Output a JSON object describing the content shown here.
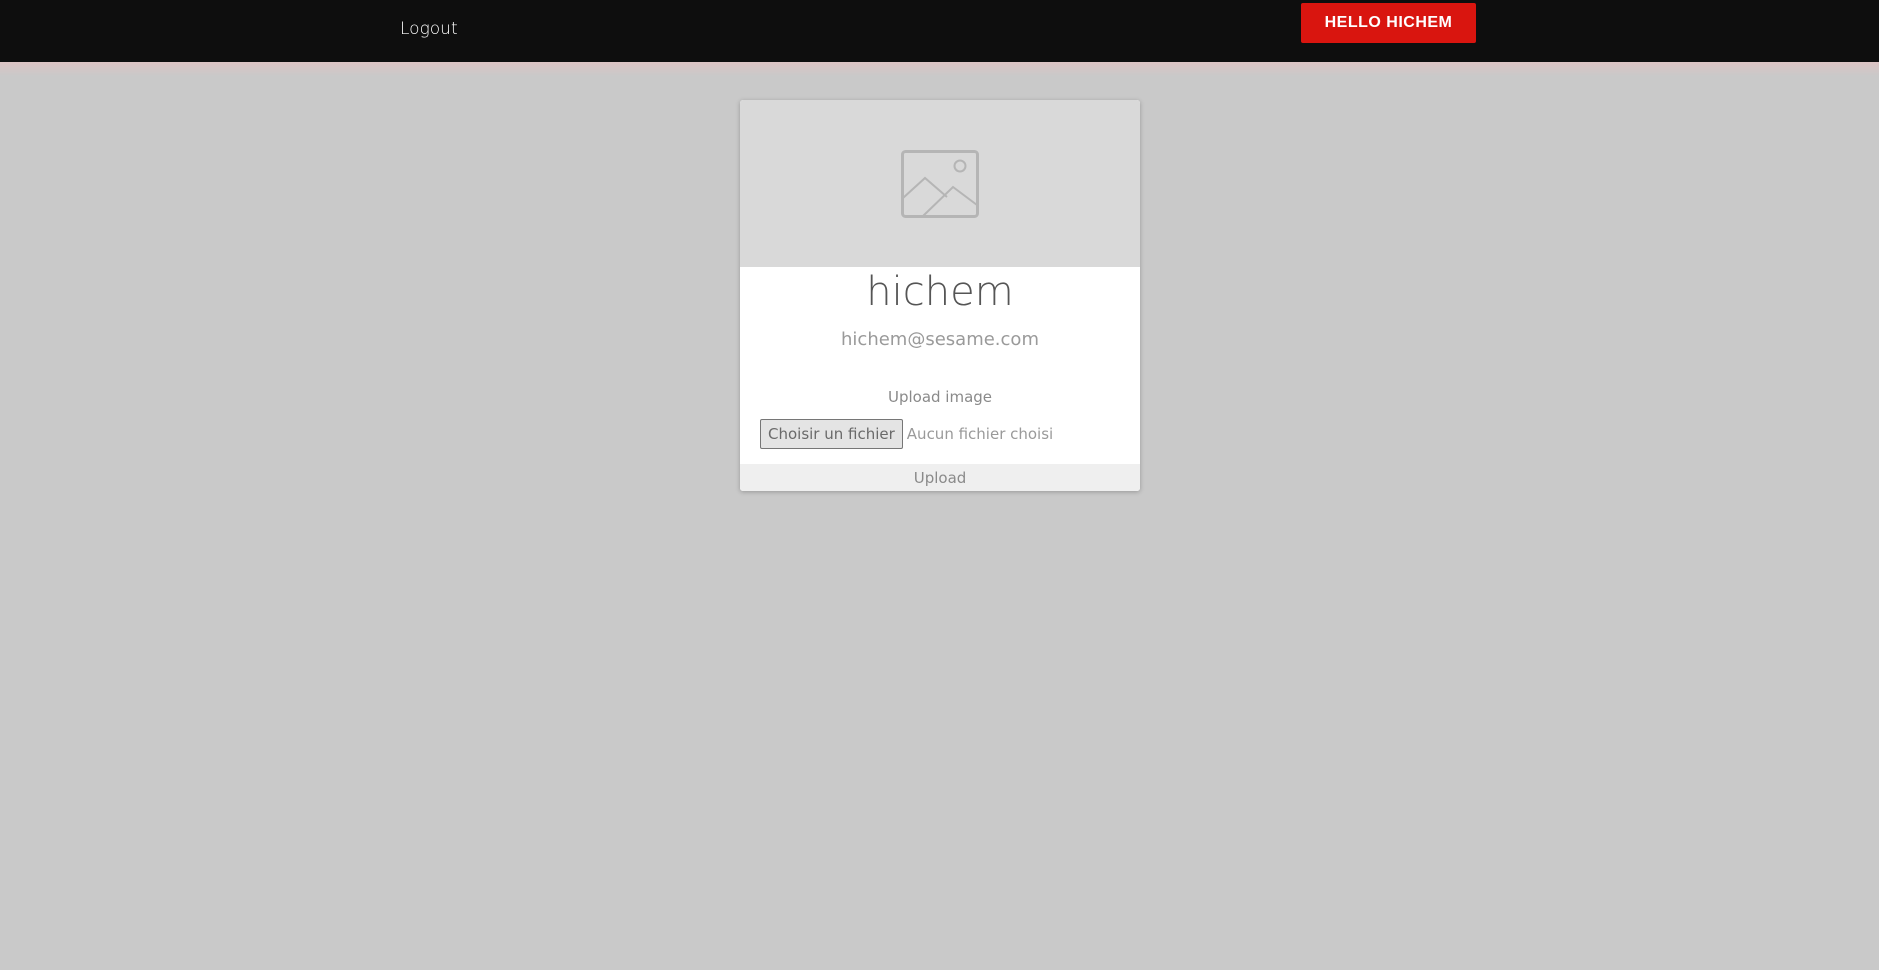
{
  "navbar": {
    "logout_label": "Logout",
    "greeting_label": "HELLO HICHEM"
  },
  "profile_card": {
    "image_icon": "image-placeholder-icon",
    "name": "hichem",
    "email": "hichem@sesame.com",
    "upload_label": "Upload image",
    "file_input": {
      "button_label": "Choisir un fichier",
      "status": "Aucun fichier choisi"
    },
    "upload_button_label": "Upload"
  },
  "colors": {
    "navbar_bg": "#0e0e0e",
    "page_bg": "#c9c9c9",
    "accent": "#d9150f"
  }
}
